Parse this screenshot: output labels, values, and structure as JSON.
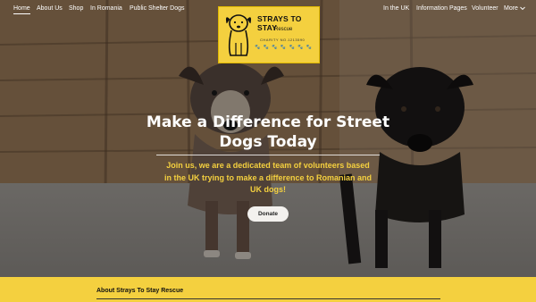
{
  "nav": {
    "left": [
      "Home",
      "About Us",
      "Shop",
      "In Romania",
      "Public Shelter Dogs"
    ],
    "right": [
      "In the UK",
      "Information Pages",
      "Volunteer",
      "More"
    ]
  },
  "logo": {
    "title": "STRAYS TO STAY",
    "subtitle": "Rescue",
    "charity": "CHARITY NO.1213590",
    "paws": "🐾 🐾 🐾 🐾 🐾 🐾 🐾"
  },
  "hero": {
    "headline_line1": "Make a Difference for Street",
    "headline_line2": "Dogs Today",
    "subtext_line1": "Join us, we are a dedicated team of volunteers based",
    "subtext_line2": "in the UK trying to make a difference to Romanian and",
    "subtext_line3": "UK dogs!",
    "donate_label": "Donate"
  },
  "about": {
    "title": "About Strays To Stay Rescue"
  },
  "colors": {
    "accent": "#f4d03f",
    "text_light": "#ffffff"
  },
  "icons": {
    "more": "chevron-down-icon",
    "logo": "sitting-dog-icon"
  }
}
